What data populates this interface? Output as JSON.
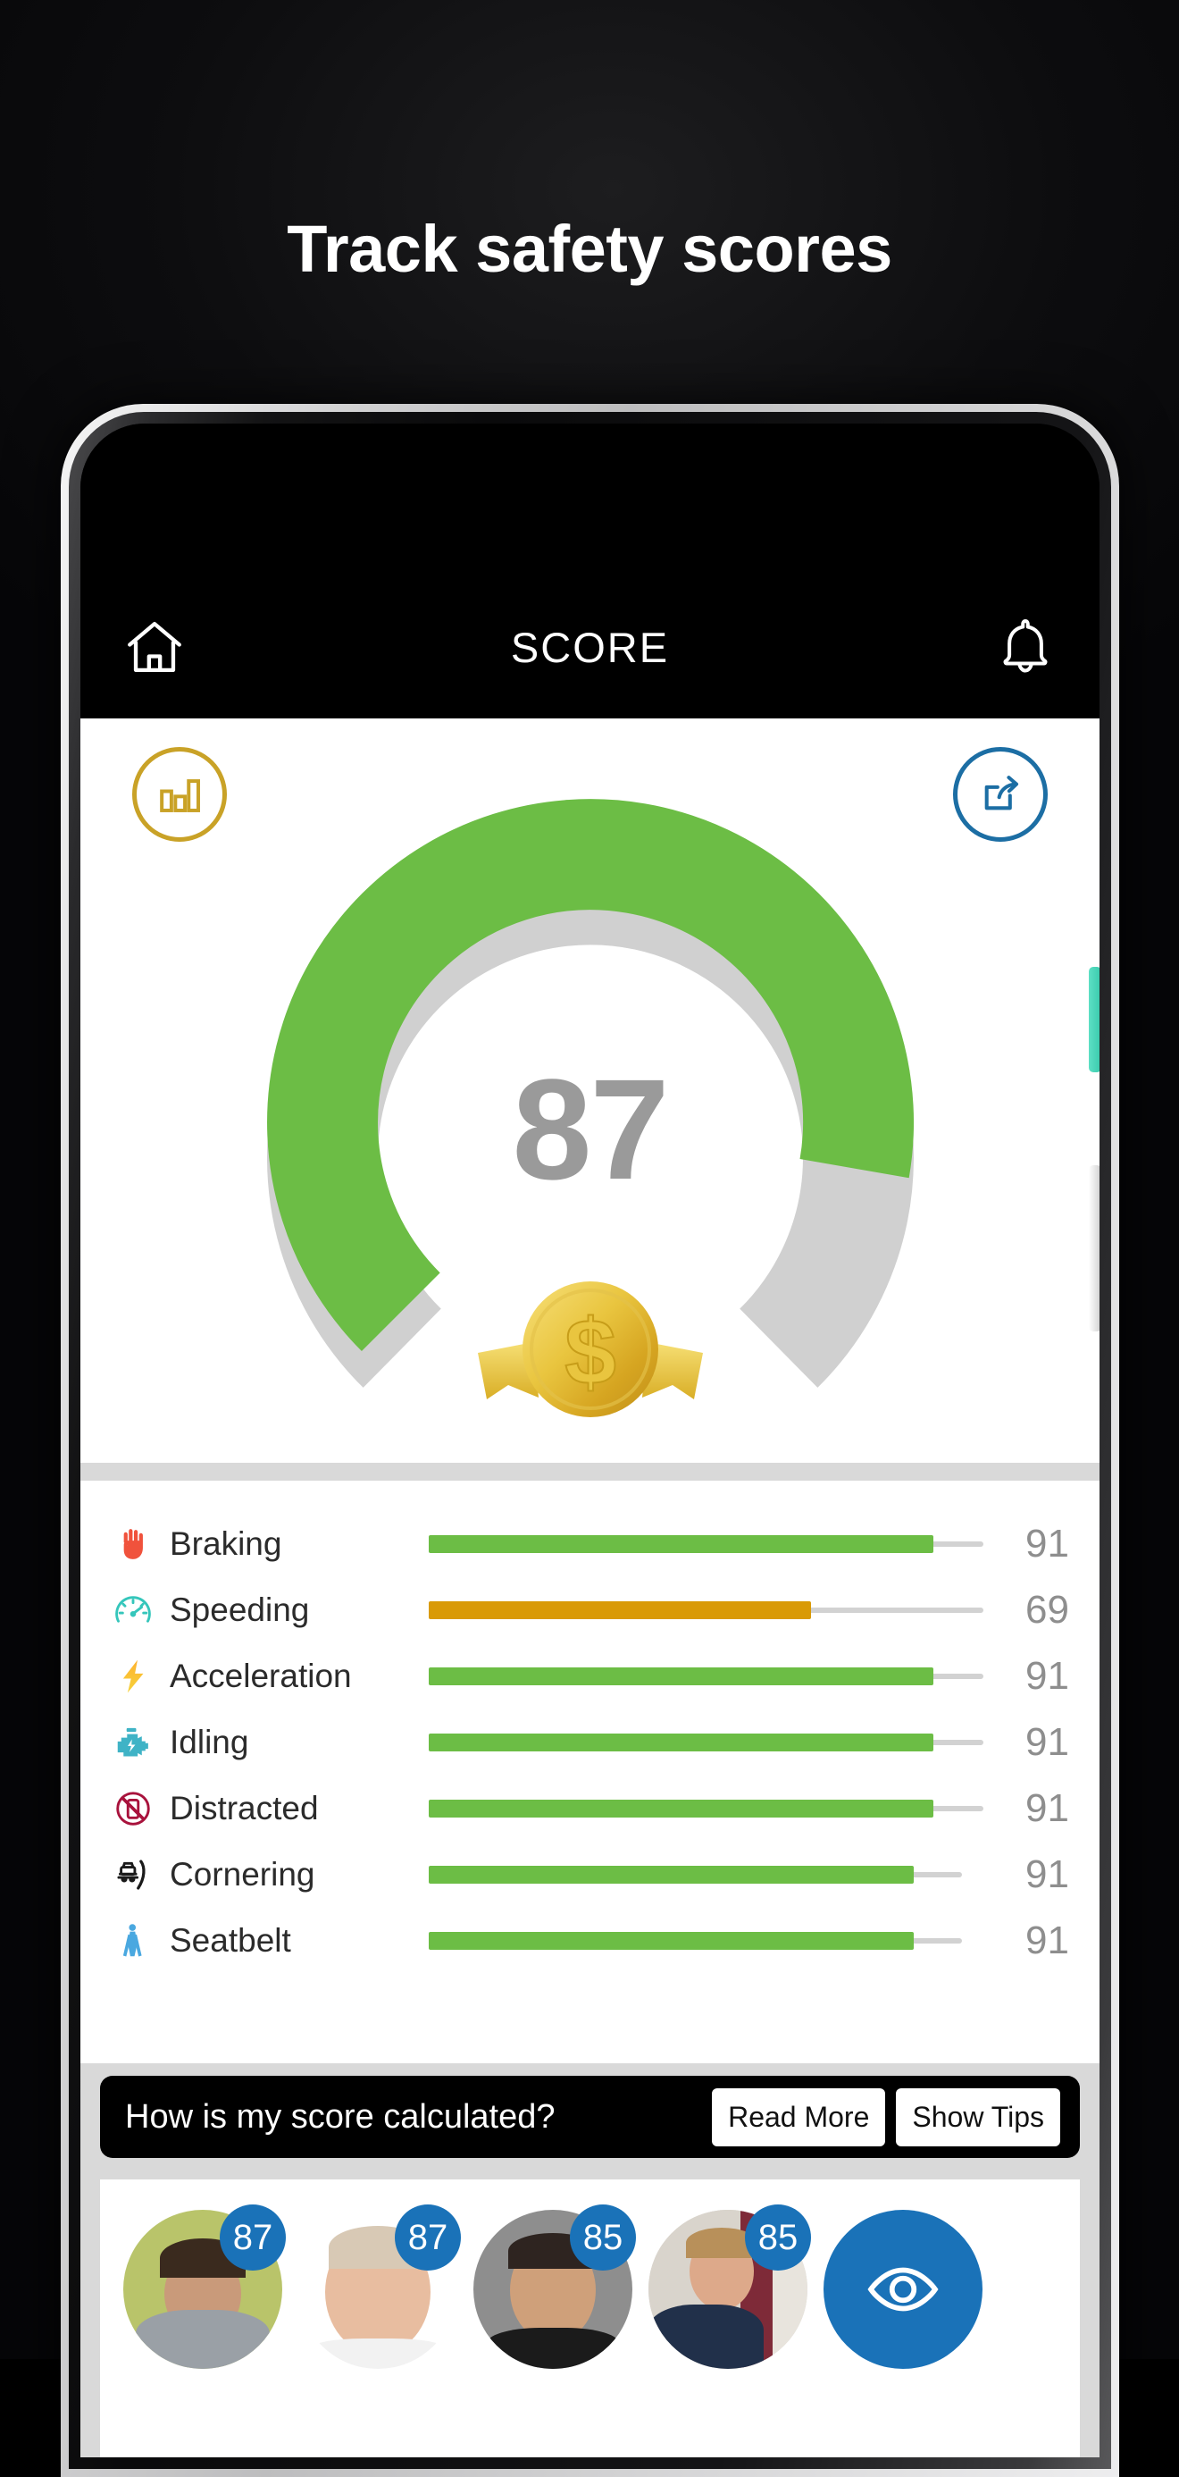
{
  "headline": "Track safety scores",
  "app": {
    "appbar": {
      "home_icon": "home-icon",
      "title": "SCORE",
      "bell_icon": "bell-icon"
    },
    "gauge": {
      "value": "87",
      "value_num": 87,
      "max": 100,
      "arc_color": "#6cbd45",
      "track_color": "#d0d0d0",
      "chart_icon": "bar-chart-icon",
      "chart_icon_color": "#c9a227",
      "share_icon": "share-icon",
      "share_icon_color": "#1c6ea4",
      "badge_icon": "gold-coin-dollar-badge"
    },
    "metrics": [
      {
        "icon": "hand-stop-icon",
        "label": "Braking",
        "score": "91",
        "value": 91,
        "color": "#6cbd45"
      },
      {
        "icon": "speedometer-icon",
        "label": "Speeding",
        "score": "69",
        "value": 69,
        "color": "#d99a06"
      },
      {
        "icon": "lightning-bolt-icon",
        "label": "Acceleration",
        "score": "91",
        "value": 91,
        "color": "#6cbd45"
      },
      {
        "icon": "engine-icon",
        "label": "Idling",
        "score": "91",
        "value": 91,
        "color": "#6cbd45"
      },
      {
        "icon": "no-phone-icon",
        "label": "Distracted",
        "score": "91",
        "value": 91,
        "color": "#6cbd45"
      },
      {
        "icon": "car-cornering-icon",
        "label": "Cornering",
        "score": "91",
        "value": 91,
        "color": "#6cbd45"
      },
      {
        "icon": "seatbelt-icon",
        "label": "Seatbelt",
        "score": "91",
        "value": 91,
        "color": "#6cbd45"
      }
    ],
    "question_bar": {
      "text": "How is my score calculated?",
      "read_more": "Read More",
      "show_tips": "Show Tips"
    },
    "people": [
      {
        "score": "87",
        "skin": "#c99a7a",
        "hair": "#3a2a1e",
        "shirt": "#9aa0a6",
        "bg": "#b9c46a",
        "hat": true
      },
      {
        "score": "87",
        "skin": "#e8bda0",
        "hair": "#d8c9b5",
        "shirt": "#ffffff",
        "bg": "#ffffff",
        "hat": false
      },
      {
        "score": "85",
        "skin": "#cfa07a",
        "hair": "#2e2420",
        "shirt": "#1b1b1b",
        "bg": "#8e8e8e",
        "hat": false
      },
      {
        "score": "85",
        "skin": "#dda98a",
        "hair": "#b8905a",
        "shirt": "#21304a",
        "bg": "#cfcac2",
        "hat": false
      }
    ],
    "eye_button_icon": "eye-icon",
    "accent_blue": "#1a72b8"
  }
}
